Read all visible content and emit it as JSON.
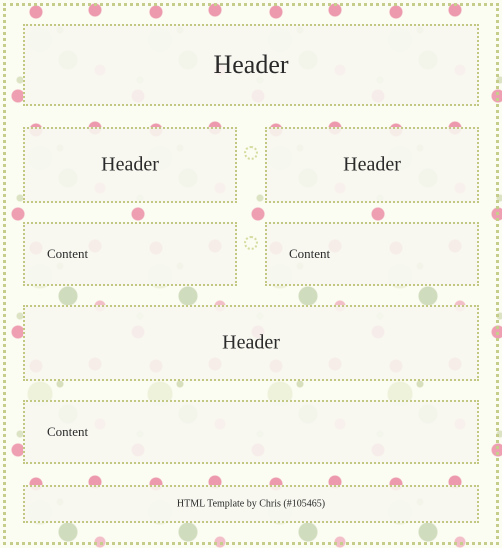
{
  "main_header": {
    "label": "Header"
  },
  "left_column": {
    "header": {
      "label": "Header"
    },
    "content": {
      "label": "Content"
    }
  },
  "right_column": {
    "header": {
      "label": "Header"
    },
    "content": {
      "label": "Content"
    }
  },
  "section_header": {
    "label": "Header"
  },
  "section_content": {
    "label": "Content"
  },
  "footer": {
    "label": "HTML Template by Chris (#105465)"
  },
  "colors": {
    "background": "#fbfcf2",
    "border": "#c2c882",
    "panel": "#f7f7f0",
    "rose": "#e878a0",
    "leaf": "#96aa5a"
  }
}
